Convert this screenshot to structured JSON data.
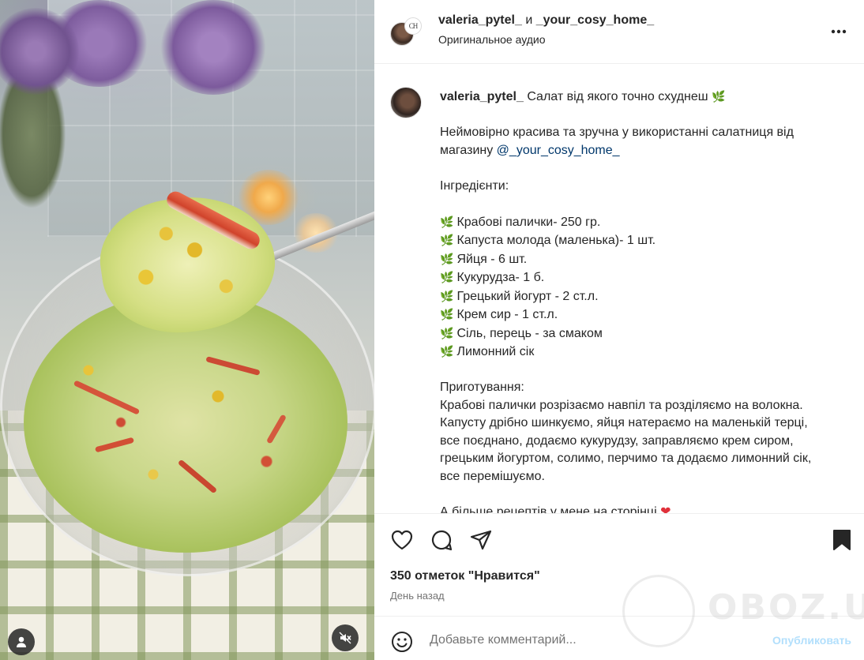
{
  "header": {
    "user1": "valeria_pytel_",
    "separator": "и",
    "user2": "_your_cosy_home_",
    "audio": "Оригинальное аудио",
    "logo_monogram": "CH"
  },
  "caption": {
    "username": "valeria_pytel_",
    "title": "Салат від якого точно схуднеш",
    "intro_line1": "Неймовірно красива та зручна у використанні салатниця від",
    "intro_line2_prefix": "магазину",
    "mention": "@_your_cosy_home_",
    "ingredients_heading": "Інгредієнти:",
    "ingredients": [
      "Крабові палички- 250 гр.",
      "Капуста молода (маленька)- 1 шт.",
      "Яйця - 6 шт.",
      "Кукурудза- 1 б.",
      "Грецький йогурт - 2 ст.л.",
      "Крем сир - 1 ст.л.",
      "Сіль, перець - за смаком",
      "Лимонний сік"
    ],
    "prep_heading": "Приготування:",
    "prep_lines": [
      "Крабові палички розрізаємо навпіл та розділяємо на волокна.",
      "Капусту дрібно шинкуємо, яйця натераємо на маленькій терці,",
      "все поєднано, додаємо кукурудзу, заправляємо крем сиром,",
      "грецьким йогуртом, солимо, перчимо та додаємо лимонний сік,",
      "все перемішуємо."
    ],
    "outro": "А більше рецептів у мене на сторінці"
  },
  "actions": {
    "likes": "350 отметок \"Нравится\"",
    "time": "День назад"
  },
  "comment": {
    "placeholder": "Добавьте комментарий...",
    "post_label": "Опубликовать"
  },
  "watermark": "OBOZ.UA",
  "icons": {
    "more": "more-horizontal-icon",
    "like": "heart-outline-icon",
    "comment": "comment-bubble-icon",
    "share": "paper-plane-icon",
    "save": "bookmark-filled-icon",
    "emoji": "smiley-icon",
    "user_tag": "person-icon",
    "mute": "speaker-muted-icon",
    "leaf": "herb-leaf-emoji",
    "heart_emoji": "red-heart-emoji"
  },
  "colors": {
    "mention": "#00376b",
    "post_button": "#b2dffc",
    "secondary_text": "#737373",
    "heart_emoji": "#e0303a",
    "leaf_emoji": "#6aa84f"
  }
}
